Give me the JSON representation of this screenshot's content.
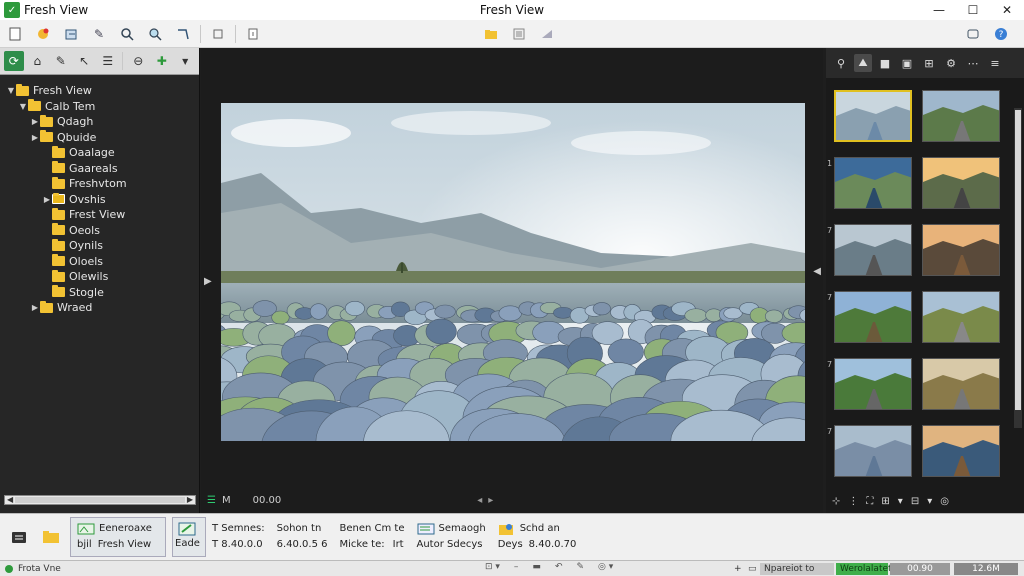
{
  "window": {
    "app_name": "Fresh View",
    "title": "Fresh View",
    "minimize": "—",
    "maximize": "☐",
    "close": "✕"
  },
  "toolbar": {
    "left": [
      "new-icon",
      "color-icon",
      "export-icon",
      "tools-icon",
      "search-icon",
      "zoom-icon",
      "edit-icon",
      "crop-icon",
      "print-icon"
    ],
    "mid": [
      "open-folder-icon",
      "list-icon",
      "send-icon"
    ],
    "right": [
      "window-icon",
      "help-icon"
    ]
  },
  "left_tools": [
    "sync-icon",
    "tag-icon",
    "pen-icon",
    "pointer-icon",
    "list-icon",
    "filter-icon",
    "plus-icon",
    "dropdown-icon"
  ],
  "tree": [
    {
      "label": "Fresh View",
      "depth": 0,
      "expanded": true,
      "special": false
    },
    {
      "label": "Calb Tem",
      "depth": 1,
      "expanded": true,
      "special": false
    },
    {
      "label": "Qdagh",
      "depth": 2,
      "expanded": false,
      "special": false
    },
    {
      "label": "Qbuide",
      "depth": 2,
      "expanded": false,
      "special": false
    },
    {
      "label": "Oaalage",
      "depth": 3,
      "expanded": null,
      "special": false
    },
    {
      "label": "Gaareals",
      "depth": 3,
      "expanded": null,
      "special": false
    },
    {
      "label": "Freshvtom",
      "depth": 3,
      "expanded": null,
      "special": false
    },
    {
      "label": "Ovshis",
      "depth": 3,
      "expanded": false,
      "special": true
    },
    {
      "label": "Frest View",
      "depth": 3,
      "expanded": null,
      "special": false
    },
    {
      "label": "Oeols",
      "depth": 3,
      "expanded": null,
      "special": false
    },
    {
      "label": "Oynils",
      "depth": 3,
      "expanded": null,
      "special": false
    },
    {
      "label": "Oloels",
      "depth": 3,
      "expanded": null,
      "special": false
    },
    {
      "label": "Olewils",
      "depth": 3,
      "expanded": null,
      "special": false
    },
    {
      "label": "Stogle",
      "depth": 3,
      "expanded": null,
      "special": false
    },
    {
      "label": "Wraed",
      "depth": 2,
      "expanded": false,
      "special": false
    }
  ],
  "viewer": {
    "status_icon": "☰",
    "status_label": "M",
    "status_value": "00.00",
    "nav_left": "◂",
    "nav_right": "▸"
  },
  "thumb_tools": [
    "filter-icon",
    "photo-icon",
    "folder-icon",
    "film-icon",
    "grid-icon",
    "settings-icon",
    "dropdown-icon",
    "more-icon"
  ],
  "thumbnails": [
    {
      "num": "",
      "kind": "lake-rocks",
      "selected": true
    },
    {
      "num": "",
      "kind": "road-green",
      "selected": false
    },
    {
      "num": "1",
      "kind": "river",
      "selected": false
    },
    {
      "num": "",
      "kind": "sunset-road",
      "selected": false
    },
    {
      "num": "7",
      "kind": "road-water",
      "selected": false
    },
    {
      "num": "",
      "kind": "boardwalk-sunset",
      "selected": false
    },
    {
      "num": "7",
      "kind": "tree-road",
      "selected": false
    },
    {
      "num": "",
      "kind": "country-road",
      "selected": false
    },
    {
      "num": "7",
      "kind": "road-field",
      "selected": false
    },
    {
      "num": "",
      "kind": "road-hills",
      "selected": false
    },
    {
      "num": "7",
      "kind": "lake-rocks2",
      "selected": false
    },
    {
      "num": "",
      "kind": "pier",
      "selected": false
    }
  ],
  "thumb_bottom": [
    "⊹",
    "⋮",
    "⛶",
    "⊞",
    "▾",
    "⊟",
    "▾",
    "◎"
  ],
  "info": {
    "b1_top": "Eeneroaxe",
    "b1_bot_a": "bjil",
    "b1_bot_b": "Fresh View",
    "b2": "Eade",
    "c1_top": "T Semnes:",
    "c1_bot": "T 8.40.0.0",
    "c2_top": "Sohon  tn",
    "c2_bot": "6.40.0.5 6",
    "c3_top": "Benen Cm te",
    "c3_bot": "Micke te:",
    "c3_top_b": "",
    "c3_bot_b": "Irt",
    "c4_top": "Semaogh",
    "c4_bot": "Autor Sdecys",
    "c5_top": "Schd an",
    "c5_bot_a": "Deys",
    "c5_bot_b": "8.40.0.70"
  },
  "status": {
    "left": "Frota Vne",
    "seg1": "Npareiot to",
    "seg2": "Werolalateten",
    "seg3": "00.90",
    "seg4": "12.6M",
    "plus": "+"
  }
}
